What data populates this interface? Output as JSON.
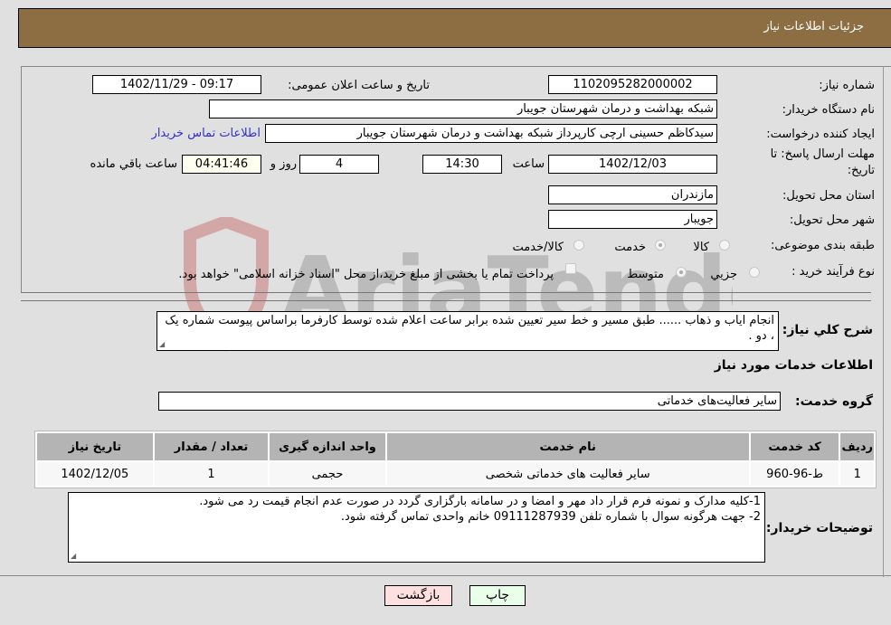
{
  "header": {
    "title": "جزئیات اطلاعات نیاز"
  },
  "form": {
    "need_number": {
      "label": "شماره نیاز:",
      "value": "1102095282000002"
    },
    "announce_datetime": {
      "label": "تاریخ و ساعت اعلان عمومی:",
      "value": "1402/11/29 - 09:17"
    },
    "buyer_org": {
      "label": "نام دستگاه خریدار:",
      "value": "شبکه بهداشت و درمان شهرستان جویبار"
    },
    "requester": {
      "label": "ایجاد کننده درخواست:",
      "value": "سیدکاظم حسینی ارچی کارپرداز شبکه بهداشت و درمان شهرستان جویبار"
    },
    "buyer_contact_link": "اطلاعات تماس خریدار",
    "deadline": {
      "label_line1": "مهلت ارسال پاسخ: تا",
      "label_line2": "تاریخ:",
      "date": "1402/12/03",
      "time_label": "ساعت",
      "time": "14:30",
      "days": "4",
      "days_label": "روز و",
      "remaining": "04:41:46",
      "remaining_label": "ساعت باقي مانده"
    },
    "province": {
      "label": "استان محل تحویل:",
      "value": "مازندران"
    },
    "city": {
      "label": "شهر محل تحویل:",
      "value": "جویبار"
    },
    "category": {
      "label": "طبقه بندی موضوعی:",
      "options": [
        {
          "label": "کالا",
          "checked": false
        },
        {
          "label": "خدمت",
          "checked": true
        },
        {
          "label": "کالا/خدمت",
          "checked": false
        }
      ]
    },
    "purchase_type": {
      "label": "نوع فرآیند خرید :",
      "options": [
        {
          "label": "جزیي",
          "checked": false
        },
        {
          "label": "متوسط",
          "checked": true
        }
      ],
      "treasury_checkbox_label": "پرداخت تمام یا بخشی از مبلغ خرید،از محل \"اسناد خزانه اسلامی\" خواهد بود.",
      "treasury_checked": false
    }
  },
  "description": {
    "label": "شرح کلي نیاز:",
    "value": "انجام ایاب و ذهاب ...... طبق مسیر و خط سیر تعیین شده برابر ساعت اعلام شده توسط کارفرما براساس پیوست شماره یک ، دو ."
  },
  "services_section": {
    "title": "اطلاعات خدمات مورد نیاز",
    "group_label": "گروه خدمت:",
    "group_value": "سایر فعالیت‌های خدماتی",
    "table": {
      "headers": [
        "ردیف",
        "کد خدمت",
        "نام خدمت",
        "واحد اندازه گیری",
        "تعداد / مقدار",
        "تاریخ نیاز"
      ],
      "rows": [
        [
          "1",
          "ط-96-960",
          "سایر فعالیت های خدماتی شخصی",
          "حجمی",
          "1",
          "1402/12/05"
        ]
      ]
    }
  },
  "buyer_notes": {
    "label": "توضیحات خریدار:",
    "lines": [
      "1-کلیه مدارک و نمونه فرم قرار داد مهر و امضا و در سامانه بارگزاری گردد در صورت عدم انجام قیمت رد می شود.",
      "2- جهت هرگونه سوال با شماره تلفن 09111287939 خانم واحدی تماس گرفته شود."
    ]
  },
  "buttons": {
    "print": "چاپ",
    "back": "بازگشت"
  },
  "watermark": {
    "text": "AriaTender.neT"
  },
  "colors": {
    "header_bg": "#8d6d42",
    "print_bg": "#eaffea",
    "back_bg": "#ffe0e0",
    "link": "#3030cc"
  }
}
